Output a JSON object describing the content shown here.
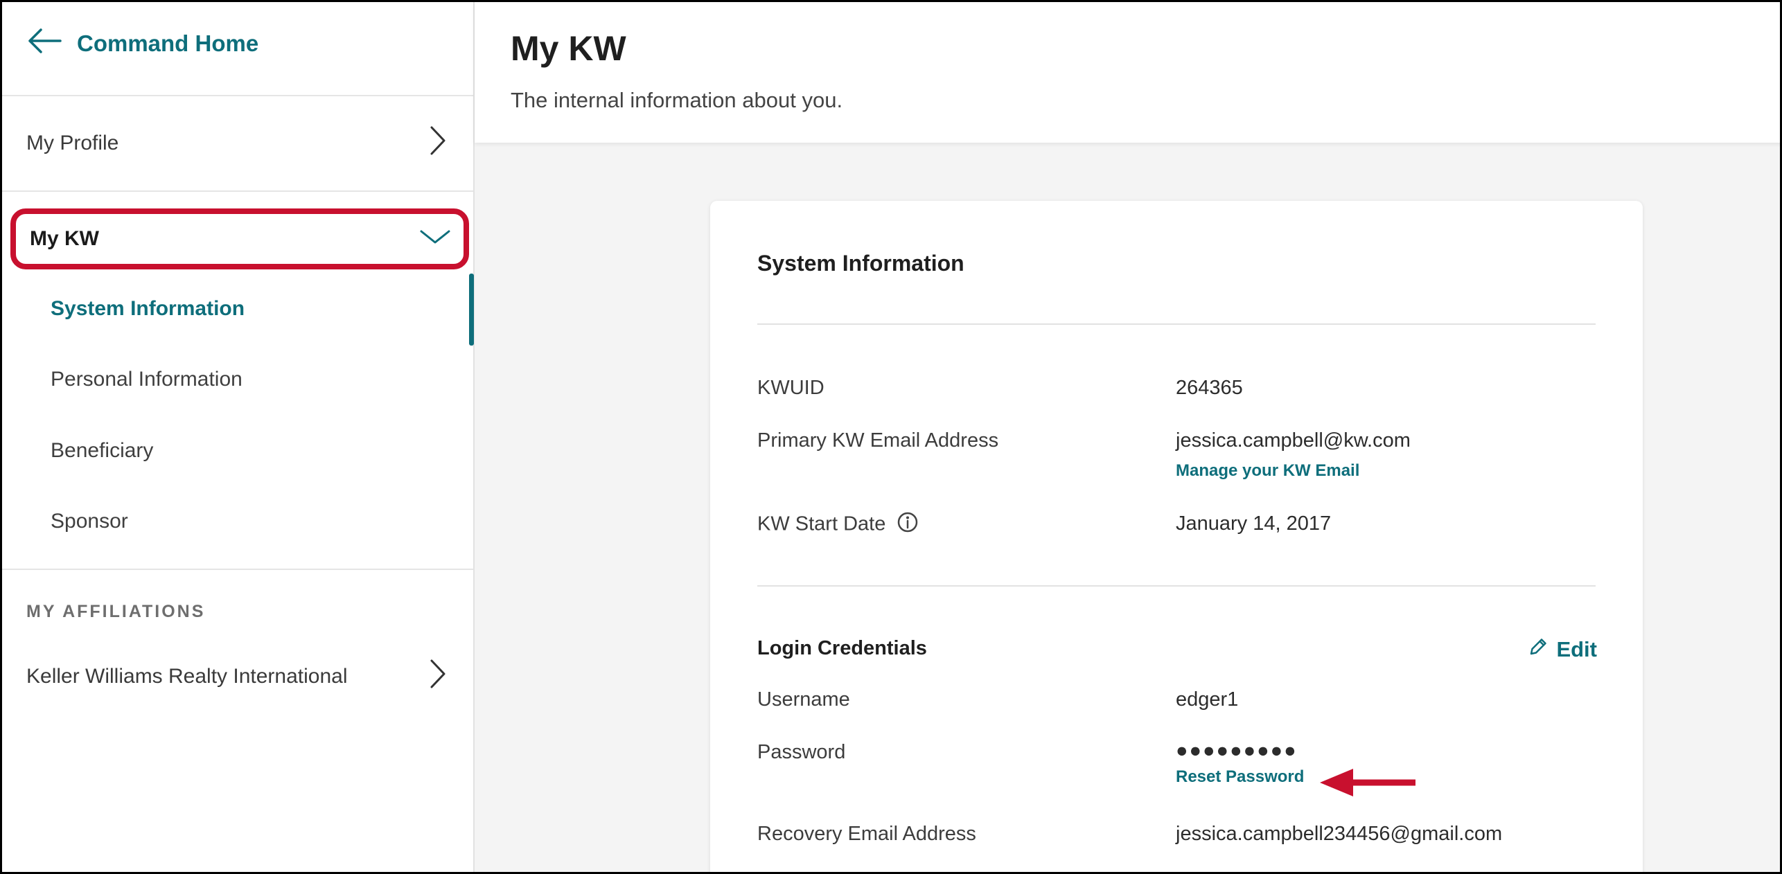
{
  "sidebar": {
    "back_link": "Command Home",
    "my_profile": "My Profile",
    "my_kw": "My KW",
    "submenu": [
      "System Information",
      "Personal Information",
      "Beneficiary",
      "Sponsor"
    ],
    "affiliations_label": "MY AFFILIATIONS",
    "affiliation": "Keller Williams Realty International"
  },
  "header": {
    "title": "My KW",
    "subtitle": "The internal information about you."
  },
  "card": {
    "title": "System Information",
    "kwuid_label": "KWUID",
    "kwuid_value": "264365",
    "email_label": "Primary KW Email Address",
    "email_value": "jessica.campbell@kw.com",
    "manage_email": "Manage your KW Email",
    "start_date_label": "KW Start Date",
    "start_date_value": "January 14, 2017",
    "login_heading": "Login Credentials",
    "edit_label": "Edit",
    "username_label": "Username",
    "username_value": "edger1",
    "password_label": "Password",
    "password_value": "●●●●●●●●●",
    "reset_password": "Reset Password",
    "recovery_label": "Recovery Email Address",
    "recovery_value": "jessica.campbell234456@gmail.com"
  },
  "colors": {
    "accent": "#0e6e7b",
    "highlight": "#c8102e"
  },
  "icons": [
    "arrow-left-icon",
    "chevron-right-icon",
    "chevron-down-icon",
    "info-icon",
    "pencil-icon",
    "red-arrow-icon"
  ]
}
